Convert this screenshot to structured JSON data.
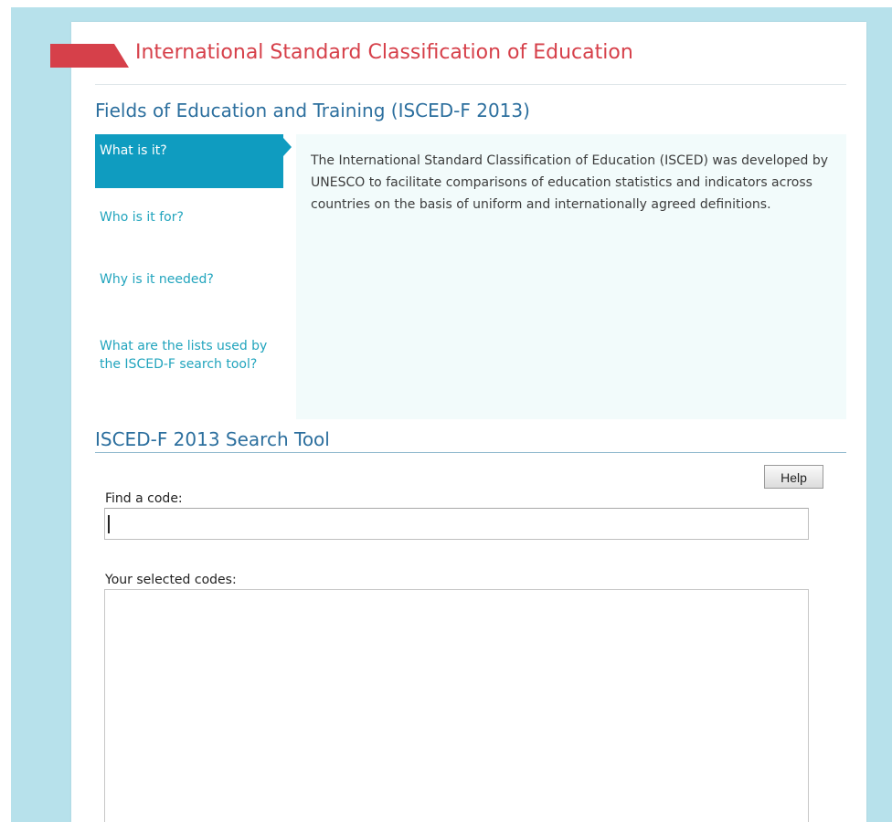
{
  "header": {
    "title": "International Standard Classification of Education",
    "accent_color": "#d6404a"
  },
  "intro": {
    "section_title": "Fields of Education and Training (ISCED-F 2013)",
    "nav": [
      {
        "label": "What is it?",
        "active": true
      },
      {
        "label": "Who is it for?",
        "active": false
      },
      {
        "label": "Why is it needed?",
        "active": false
      },
      {
        "label": "What are the lists used by the ISCED-F search tool?",
        "active": false
      }
    ],
    "content": "The International Standard Classification of Education (ISCED) was developed by UNESCO to facilitate comparisons of education statistics and indicators across countries on the basis of uniform and internationally agreed definitions."
  },
  "search_tool": {
    "title": "ISCED-F 2013 Search Tool",
    "help_label": "Help",
    "find_label": "Find a code:",
    "find_value": "",
    "selected_label": "Your selected codes:"
  },
  "colors": {
    "backdrop": "#b7e1eb",
    "nav_active": "#0f9cc0",
    "nav_link": "#21a4bd",
    "heading": "#2c6f9e"
  }
}
